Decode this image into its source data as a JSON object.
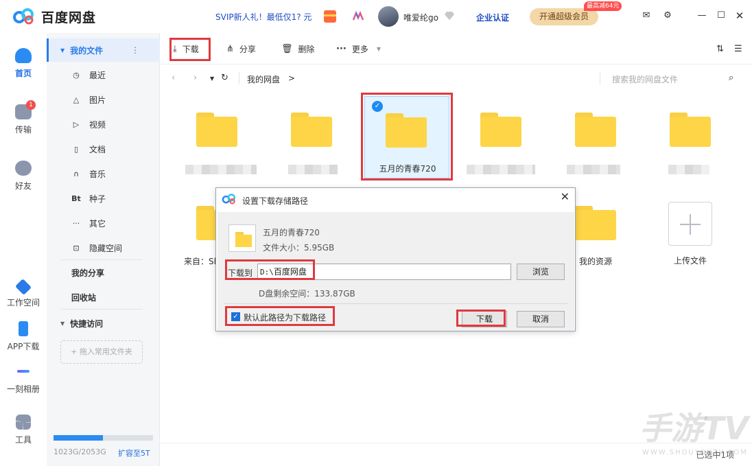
{
  "app": {
    "name": "百度网盘"
  },
  "titlebar": {
    "promo": "SVIP新人礼！最低仅1? 元",
    "username": "唯爱纶go",
    "enterprise": "企业认证",
    "vip_button": "开通超级会员",
    "vip_badge": "最高减64元"
  },
  "rail": [
    {
      "label": "首页",
      "icon": "cloud-icon"
    },
    {
      "label": "传输",
      "icon": "transfer-icon",
      "badge": "1"
    },
    {
      "label": "好友",
      "icon": "friends-icon"
    },
    {
      "label": "工作空间",
      "icon": "workspace-icon"
    },
    {
      "label": "APP下载",
      "icon": "phone-icon"
    },
    {
      "label": "一刻相册",
      "icon": "album-icon"
    },
    {
      "label": "工具",
      "icon": "tools-icon"
    }
  ],
  "sidebar": {
    "my_files": "我的文件",
    "items": [
      {
        "label": "最近",
        "icon": "clock-icon"
      },
      {
        "label": "图片",
        "icon": "image-icon"
      },
      {
        "label": "视频",
        "icon": "play-icon"
      },
      {
        "label": "文档",
        "icon": "document-icon"
      },
      {
        "label": "音乐",
        "icon": "headphones-icon"
      },
      {
        "label": "种子",
        "icon": "bt-icon",
        "glyph": "Bt"
      },
      {
        "label": "其它",
        "icon": "more-icon"
      },
      {
        "label": "隐藏空间",
        "icon": "lock-icon"
      }
    ],
    "my_share": "我的分享",
    "recycle": "回收站",
    "quick_access": "快捷访问",
    "drop_hint": "+ 拖入常用文件夹",
    "quota": "1023G/2053G",
    "quota_fraction": 0.4983,
    "expand": "扩容至5T"
  },
  "toolbar": {
    "download": "下载",
    "share": "分享",
    "delete": "删除",
    "more": "更多"
  },
  "breadcrumb": {
    "path": "我的网盘",
    "separator": ">",
    "search_placeholder": "搜索我的网盘文件"
  },
  "files": {
    "selected_name": "五月的青春720",
    "row2_first_prefix": "来自：Sl",
    "my_resources": "我的资源",
    "upload": "上传文件"
  },
  "dialog": {
    "title": "设置下载存储路径",
    "file_name": "五月的青春720",
    "file_size": "文件大小：5.95GB",
    "download_to": "下载到",
    "path_prefix": "D:\\",
    "path_name": "百度网盘",
    "browse": "浏览",
    "free_space": "D盘剩余空间：133.87GB",
    "default_checkbox": "默认此路径为下载路径",
    "confirm": "下载",
    "cancel": "取消"
  },
  "status": {
    "selected": "已选中1项"
  },
  "watermark": {
    "main": "手游TV",
    "sub": "WWW.SHOUYOUTV.COM"
  },
  "colors": {
    "accent": "#2a7be9",
    "highlight": "#e0393e",
    "folder": "#fdd546"
  }
}
